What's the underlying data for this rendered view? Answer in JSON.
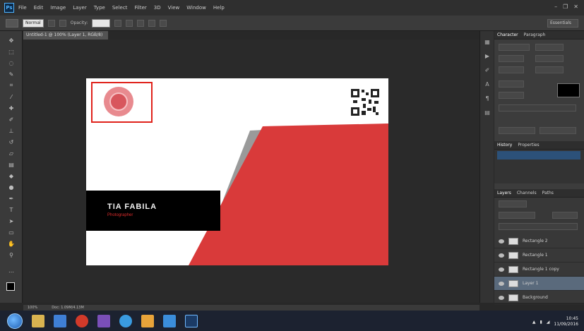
{
  "app": {
    "logo_text": "Ps",
    "menu": [
      "File",
      "Edit",
      "Image",
      "Layer",
      "Type",
      "Select",
      "Filter",
      "3D",
      "View",
      "Window",
      "Help"
    ],
    "window_controls": [
      "–",
      "❐",
      "✕"
    ]
  },
  "options_bar": {
    "mode_label": "Normal",
    "opacity_label": "Opacity:",
    "workspace": "Essentials"
  },
  "document": {
    "tab_title": "Untitled-1 @ 100% (Layer 1, RGB/8)"
  },
  "card": {
    "name": "TIA FABILA",
    "subtitle": "Photographer",
    "colors": {
      "red": "#d93a3a",
      "black": "#000000",
      "white": "#ffffff",
      "logo": "#e88a8f"
    }
  },
  "panels": {
    "character_tabs": [
      "Character",
      "Paragraph"
    ],
    "history_tabs": [
      "History",
      "Properties"
    ],
    "layers_tabs": [
      "Layers",
      "Channels",
      "Paths"
    ],
    "layers": [
      {
        "name": "Rectangle 2",
        "selected": false
      },
      {
        "name": "Rectangle 1",
        "selected": false
      },
      {
        "name": "Rectangle 1 copy",
        "selected": false
      },
      {
        "name": "Layer 1",
        "selected": true
      },
      {
        "name": "Background",
        "selected": false
      }
    ],
    "accent_color": "#2c5179"
  },
  "status": {
    "zoom": "100%",
    "doc_info": "Doc: 1.09M/4.13M"
  },
  "taskbar": {
    "icons": [
      "explorer-icon",
      "media-icon",
      "opera-icon",
      "vs-icon",
      "chrome-icon",
      "files-icon",
      "ie-icon",
      "photoshop-icon"
    ],
    "time": "10:45",
    "date": "11/09/2016"
  }
}
